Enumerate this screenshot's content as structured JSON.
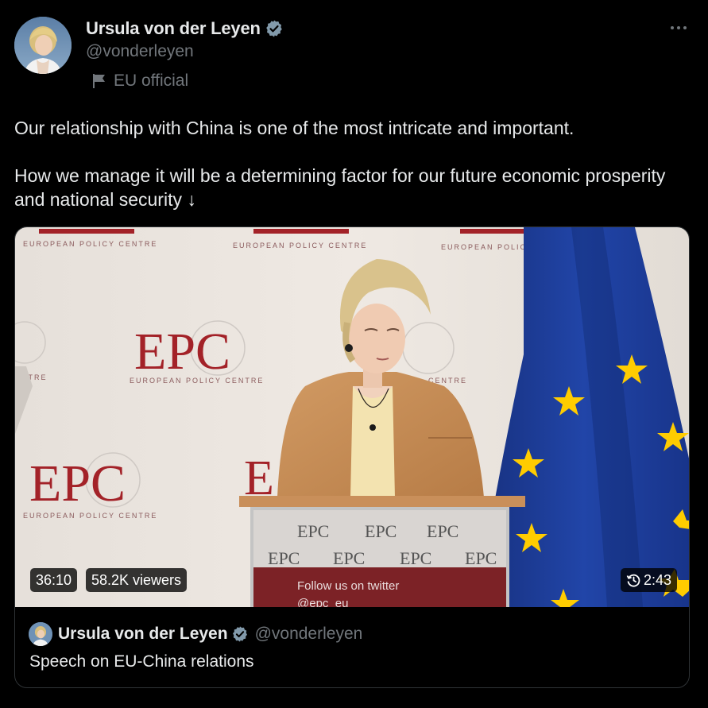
{
  "author": {
    "name": "Ursula von der Leyen",
    "handle": "@vonderleyen",
    "affiliation": "EU official",
    "verified_icon": "verified-badge-icon",
    "avatar_icon": "profile-photo"
  },
  "menu": {
    "more_icon": "more-dots-icon"
  },
  "tweet": {
    "paragraph_1": "Our relationship with China is one of the most intricate and important.",
    "paragraph_2": "How we manage it will be a determining factor for our future economic prosperity and national security ↓"
  },
  "video": {
    "duration": "36:10",
    "viewers": "58.2K viewers",
    "replay_time": "2:43",
    "replay_icon": "replay-clock-icon",
    "backdrop_logo": "EPC",
    "backdrop_caption": "EUROPEAN POLICY CENTRE",
    "podium_caption": "POLICY CENTRE",
    "podium_follow": "Follow us on twitter",
    "podium_handle": "@epc_eu"
  },
  "quote": {
    "name": "Ursula von der Leyen",
    "handle": "@vonderleyen",
    "title": "Speech on EU-China relations"
  },
  "colors": {
    "background": "#000000",
    "text_primary": "#e7e9ea",
    "text_secondary": "#71767b",
    "verified_blue": "#1d9bf0",
    "border": "#2f3336",
    "epc_red": "#a32228",
    "eu_blue": "#1d3c9a",
    "eu_gold": "#ffcc00"
  }
}
